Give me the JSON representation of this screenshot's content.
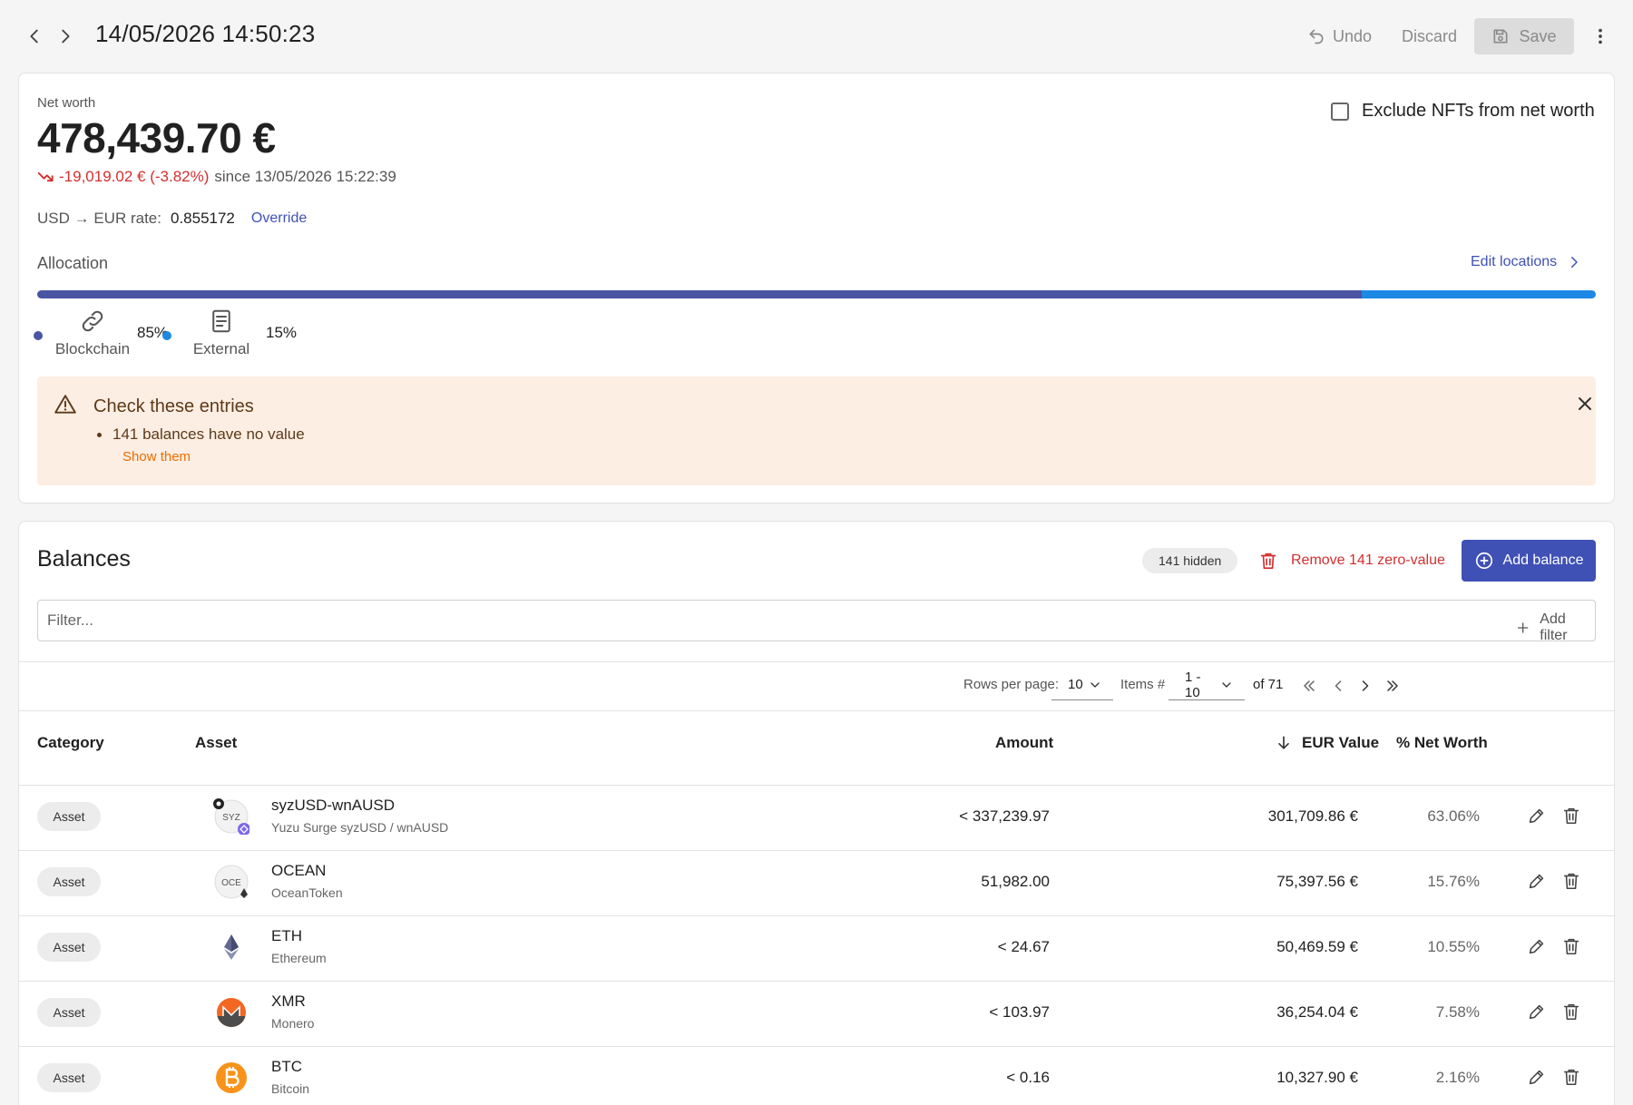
{
  "header": {
    "datetime": "14/05/2026 14:50:23",
    "undo_label": "Undo",
    "discard_label": "Discard",
    "save_label": "Save"
  },
  "net_worth": {
    "label": "Net worth",
    "value": "478,439.70 €",
    "change": "-19,019.02 € (-3.82%)",
    "since": "since 13/05/2026 15:22:39",
    "rate_label": "USD → EUR rate:",
    "rate_value": "0.855172",
    "override_label": "Override",
    "exclude_nfts_label": "Exclude NFTs from net worth",
    "exclude_nfts_checked": false
  },
  "allocation": {
    "label": "Allocation",
    "edit_label": "Edit locations",
    "items": [
      {
        "name": "Blockchain",
        "percent": "85%",
        "fraction": 0.85,
        "color": "#4a55a2",
        "icon": "link-icon"
      },
      {
        "name": "External",
        "percent": "15%",
        "fraction": 0.15,
        "color": "#1e88e5",
        "icon": "document-icon"
      }
    ]
  },
  "alert": {
    "title": "Check these entries",
    "item": "141 balances have no value",
    "link": "Show them"
  },
  "balances": {
    "title": "Balances",
    "hidden_chip": "141 hidden",
    "remove_label": "Remove 141 zero-value",
    "add_label": "Add balance",
    "filter_placeholder": "Filter...",
    "add_filter_label": "Add filter",
    "pager": {
      "rows_per_page_label": "Rows per page:",
      "rows_per_page": "10",
      "items_label": "Items #",
      "items_range": "1 - 10",
      "of_total": "of 71"
    },
    "columns": {
      "category": "Category",
      "asset": "Asset",
      "amount": "Amount",
      "value": "EUR Value",
      "percent": "% Net Worth"
    },
    "rows": [
      {
        "category": "Asset",
        "symbol": "syzUSD-wnAUSD",
        "name": "Yuzu Surge syzUSD / wnAUSD",
        "amount": "< 337,239.97",
        "value": "301,709.86 €",
        "percent": "63.06%",
        "icon": "syz-token-icon",
        "icon_text": "SYZ"
      },
      {
        "category": "Asset",
        "symbol": "OCEAN",
        "name": "OceanToken",
        "amount": "51,982.00",
        "value": "75,397.56 €",
        "percent": "15.76%",
        "icon": "ocean-token-icon",
        "icon_text": "OCE"
      },
      {
        "category": "Asset",
        "symbol": "ETH",
        "name": "Ethereum",
        "amount": "< 24.67",
        "value": "50,469.59 €",
        "percent": "10.55%",
        "icon": "ethereum-icon",
        "icon_text": ""
      },
      {
        "category": "Asset",
        "symbol": "XMR",
        "name": "Monero",
        "amount": "< 103.97",
        "value": "36,254.04 €",
        "percent": "7.58%",
        "icon": "monero-icon",
        "icon_text": ""
      },
      {
        "category": "Asset",
        "symbol": "BTC",
        "name": "Bitcoin",
        "amount": "< 0.16",
        "value": "10,327.90 €",
        "percent": "2.16%",
        "icon": "bitcoin-icon",
        "icon_text": ""
      }
    ]
  },
  "colors": {
    "primary": "#3f51b5",
    "negative": "#d32f2f",
    "warning_bg": "#fdeee3",
    "warning_link": "#ef6c00"
  }
}
